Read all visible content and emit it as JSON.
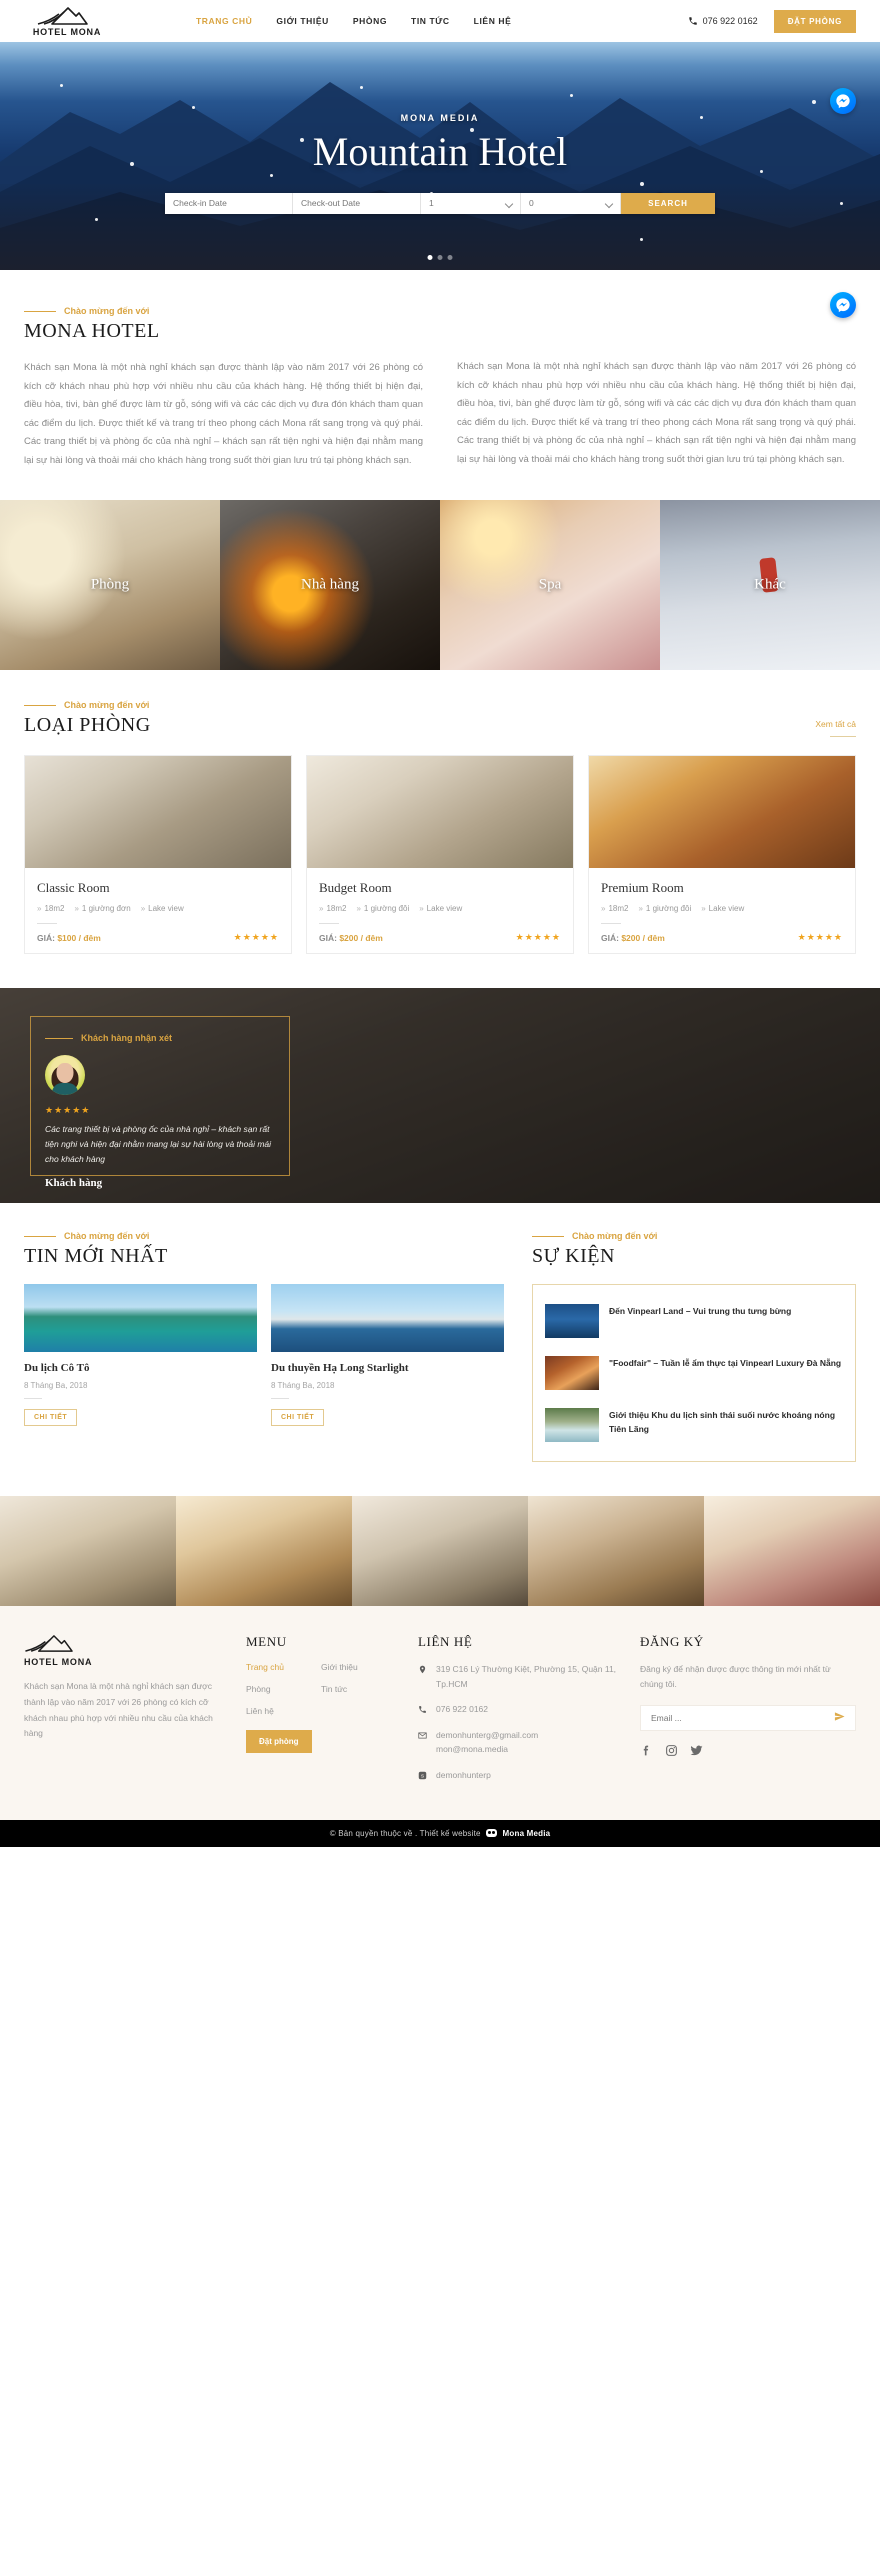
{
  "header": {
    "logo_text": "HOTEL MONA",
    "nav": [
      {
        "label": "TRANG CHỦ",
        "active": true
      },
      {
        "label": "GIỚI THIỆU",
        "active": false
      },
      {
        "label": "PHÒNG",
        "active": false
      },
      {
        "label": "TIN TỨC",
        "active": false
      },
      {
        "label": "LIÊN HỆ",
        "active": false
      }
    ],
    "phone": "076 922 0162",
    "book_button": "ĐẶT PHÒNG"
  },
  "hero": {
    "kicker": "MONA MEDIA",
    "title": "Mountain Hotel",
    "search": {
      "checkin_placeholder": "Check-in Date",
      "checkout_placeholder": "Check-out Date",
      "adults_value": "1",
      "children_value": "0",
      "button": "SEARCH"
    },
    "slides": 3,
    "active_slide": 1
  },
  "about": {
    "kicker": "Chào mừng đến với",
    "title": "MONA HOTEL",
    "paragraph_left": "Khách sạn Mona là một nhà nghỉ khách sạn được thành lập vào năm 2017 với 26 phòng có kích cỡ khách nhau phù hợp với nhiều nhu cầu của khách hàng. Hệ thống thiết bị hiện đại, điều hòa, tivi, bàn ghế được làm từ gỗ, sóng wifi và các các dịch vụ đưa đón khách tham quan các điểm du lịch. Được thiết kế và trang trí theo phong cách Mona rất sang trọng và quý phái. Các trang thiết bị và phòng ốc của nhà nghỉ – khách sạn rất tiện nghi và hiện đại nhằm mang lại sự hài lòng và thoải mái cho khách hàng trong suốt thời gian lưu trú tại phòng khách sạn.",
    "paragraph_right": "Khách sạn Mona là một nhà nghỉ khách sạn được thành lập vào năm 2017 với 26 phòng có kích cỡ khách nhau phù hợp với nhiều nhu cầu của khách hàng. Hệ thống thiết bị hiện đại, điều hòa, tivi, bàn ghế được làm từ gỗ, sóng wifi và các các dịch vụ đưa đón khách tham quan các điểm du lịch. Được thiết kế và trang trí theo phong cách Mona rất sang trọng và quý phái. Các trang thiết bị và phòng ốc của nhà nghỉ – khách sạn rất tiện nghi và hiện đại nhằm mang lại sự hài lòng và thoải mái cho khách hàng trong suốt thời gian lưu trú tại phòng khách sạn."
  },
  "categories": [
    {
      "label": "Phòng"
    },
    {
      "label": "Nhà hàng"
    },
    {
      "label": "Spa"
    },
    {
      "label": "Khác"
    }
  ],
  "rooms": {
    "kicker": "Chào mừng đến với",
    "title": "LOẠI PHÒNG",
    "view_all": "Xem tất cả",
    "items": [
      {
        "name": "Classic Room",
        "size": "18m2",
        "bed": "1 giường đơn",
        "view": "Lake view",
        "price_label": "GIÁ:",
        "price": "$100 / đêm",
        "stars": "★★★★★"
      },
      {
        "name": "Budget Room",
        "size": "18m2",
        "bed": "1 giường đôi",
        "view": "Lake view",
        "price_label": "GIÁ:",
        "price": "$200 / đêm",
        "stars": "★★★★★"
      },
      {
        "name": "Premium Room",
        "size": "18m2",
        "bed": "1 giường đôi",
        "view": "Lake view",
        "price_label": "GIÁ:",
        "price": "$200 / đêm",
        "stars": "★★★★★"
      }
    ]
  },
  "testimonial": {
    "kicker": "Khách hàng nhận xét",
    "stars": "★★★★★",
    "quote": "Các trang thiết bị và phòng ốc của nhà nghỉ – khách sạn rất tiện nghi và hiện đại nhằm mang lại sự hài lòng và thoải mái cho khách hàng",
    "author": "Khách hàng"
  },
  "news": {
    "kicker": "Chào mừng đến với",
    "title": "TIN MỚI NHẤT",
    "items": [
      {
        "title": "Du lịch Cô Tô",
        "date": "8 Tháng Ba, 2018",
        "button": "CHI TIẾT"
      },
      {
        "title": "Du thuyền Hạ Long Starlight",
        "date": "8 Tháng Ba, 2018",
        "button": "CHI TIẾT"
      }
    ]
  },
  "events": {
    "kicker": "Chào mừng đến với",
    "title": "SỰ KIỆN",
    "items": [
      {
        "title": "Đến Vinpearl Land – Vui trung thu tưng bừng"
      },
      {
        "title": "\"Foodfair\" – Tuần lễ ẩm thực tại Vinpearl Luxury Đà Nẵng"
      },
      {
        "title": "Giới thiệu Khu du lịch sinh thái suối nước khoáng nóng Tiên Lãng"
      }
    ]
  },
  "footer": {
    "logo_text": "HOTEL MONA",
    "about": "Khách sạn Mona là một nhà nghỉ khách sạn được thành lập vào năm 2017 với 26 phòng có kích cỡ khách nhau phù hợp với nhiều nhu cầu của khách hàng",
    "menu_title": "MENU",
    "menu": [
      {
        "label": "Trang chủ",
        "active": true
      },
      {
        "label": "Giới thiệu",
        "active": false
      },
      {
        "label": "Phòng",
        "active": false
      },
      {
        "label": "Tin tức",
        "active": false
      },
      {
        "label": "Liên hệ",
        "active": false
      }
    ],
    "book_button": "Đặt phòng",
    "contact_title": "LIÊN HỆ",
    "contact": {
      "address": "319 C16 Lý Thường Kiệt, Phường 15, Quận 11, Tp.HCM",
      "phone": "076 922 0162",
      "email": "demonhunterg@gmail.com\nmon@mona.media",
      "skype": "demonhunterp"
    },
    "subscribe_title": "ĐĂNG KÝ",
    "subscribe_desc": "Đăng ký để nhận được được thông tin mới nhất từ chúng tôi.",
    "email_placeholder": "Email ...",
    "socials": [
      "facebook-icon",
      "instagram-icon",
      "twitter-icon"
    ]
  },
  "copyright": {
    "prefix": "© Bản quyền thuộc về . Thiết kế website",
    "brand": "Mona Media"
  },
  "colors": {
    "accent": "#d9a441",
    "accent_button": "#deab4b",
    "dark": "#1c1c1c",
    "muted": "#9a9a9a",
    "star": "#f0a41e",
    "messenger": "#00b2ff"
  }
}
